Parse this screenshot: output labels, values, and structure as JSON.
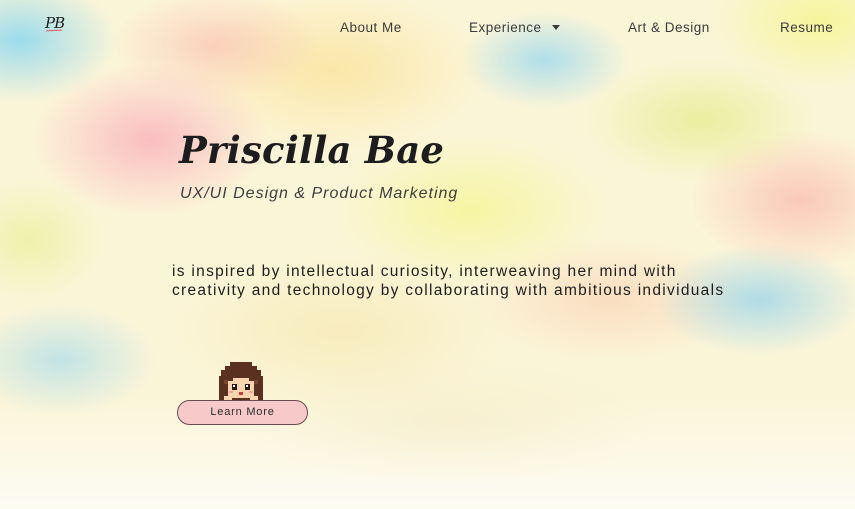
{
  "logo": {
    "text": "PB"
  },
  "nav": {
    "about": "About Me",
    "experience": "Experience",
    "experience_caret_icon": "caret-down-icon",
    "art": "Art & Design",
    "resume": "Resume"
  },
  "hero": {
    "name": "Priscilla Bae",
    "subtitle": "UX/UI Design & Product Marketing",
    "tagline": "is inspired by intellectual curiosity, interweaving her mind with creativity and technology by collaborating with ambitious individuals",
    "avatar_icon": "pixel-girl-avatar-icon",
    "cta_label": "Learn More"
  },
  "colors": {
    "text_dark": "#1d1d1f",
    "cta_background": "#f8c9c9",
    "cta_border": "#6a4b50",
    "logo_underline": "#e05568"
  }
}
